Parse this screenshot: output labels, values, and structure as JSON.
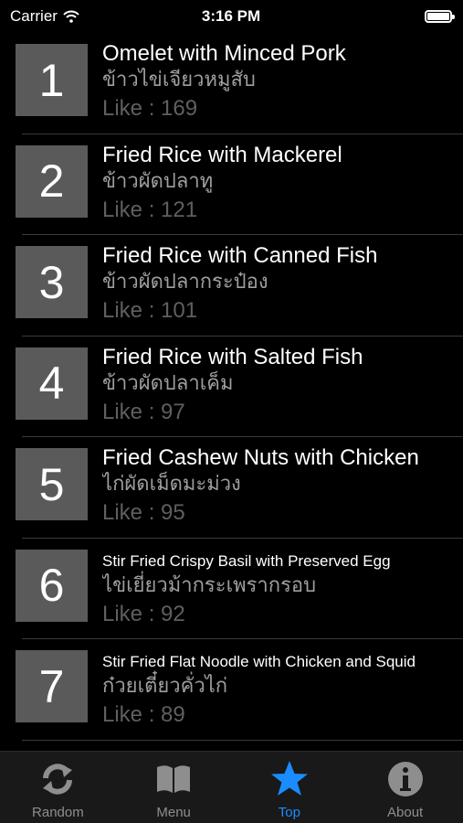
{
  "status_bar": {
    "carrier": "Carrier",
    "time": "3:16 PM"
  },
  "items": [
    {
      "rank": "1",
      "title": "Omelet with Minced Pork",
      "thai": "ข้าวไข่เจียวหมูสับ",
      "likes": "Like : 169"
    },
    {
      "rank": "2",
      "title": "Fried Rice with Mackerel",
      "thai": "ข้าวผัดปลาทู",
      "likes": "Like : 121"
    },
    {
      "rank": "3",
      "title": "Fried Rice with Canned Fish",
      "thai": "ข้าวผัดปลากระป๋อง",
      "likes": "Like : 101"
    },
    {
      "rank": "4",
      "title": "Fried Rice with Salted Fish",
      "thai": "ข้าวผัดปลาเค็ม",
      "likes": "Like : 97"
    },
    {
      "rank": "5",
      "title": "Fried Cashew Nuts with Chicken",
      "thai": "ไก่ผัดเม็ดมะม่วง",
      "likes": "Like : 95"
    },
    {
      "rank": "6",
      "title": "Stir Fried Crispy Basil with Preserved Egg",
      "thai": "ไข่เยี่ยวม้ากระเพรากรอบ",
      "likes": "Like : 92"
    },
    {
      "rank": "7",
      "title": "Stir Fried Flat Noodle with Chicken and Squid",
      "thai": "ก๋วยเตี๋ยวคั่วไก่",
      "likes": "Like : 89"
    }
  ],
  "tabs": [
    {
      "label": "Random",
      "icon": "random-icon"
    },
    {
      "label": "Menu",
      "icon": "book-icon"
    },
    {
      "label": "Top",
      "icon": "star-icon"
    },
    {
      "label": "About",
      "icon": "info-icon"
    }
  ],
  "colors": {
    "accent": "#1a8cff",
    "rank_box": "#5a5a5a",
    "inactive": "#8e8e8e"
  }
}
